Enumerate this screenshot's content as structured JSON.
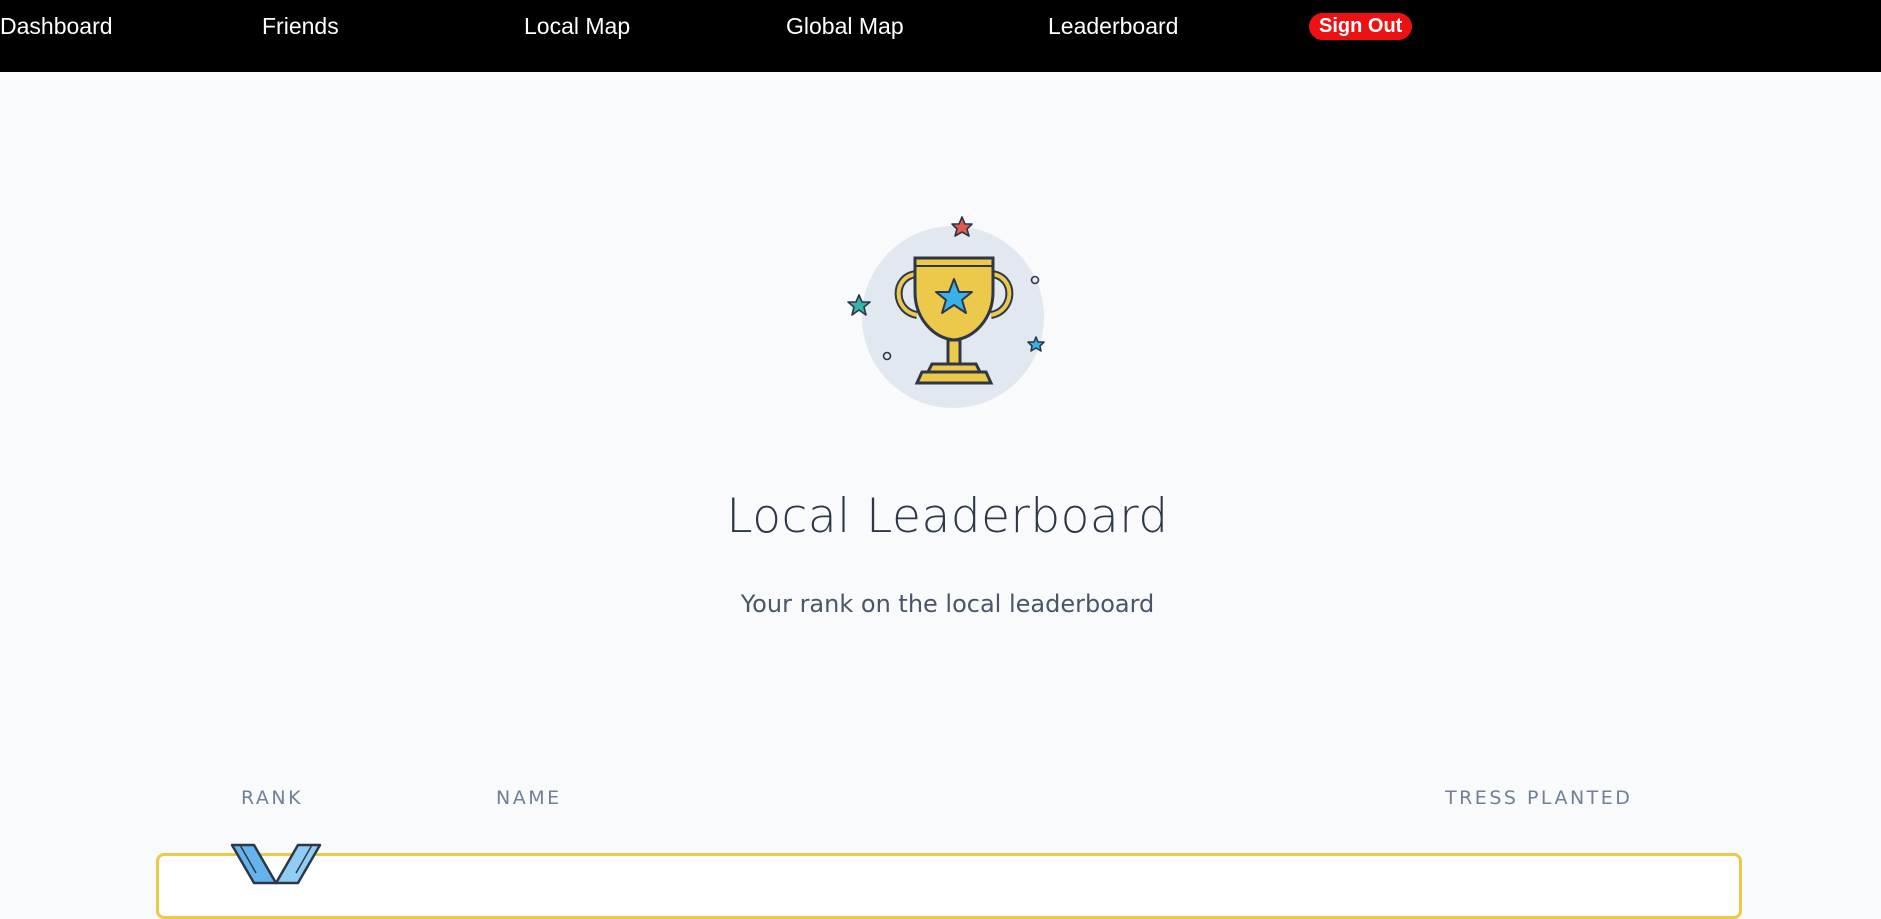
{
  "nav": {
    "links": [
      "Dashboard",
      "Friends",
      "Local Map",
      "Global Map",
      "Leaderboard"
    ],
    "signout_label": "Sign Out"
  },
  "hero": {
    "title": "Local Leaderboard",
    "subtitle": "Your rank on the local leaderboard"
  },
  "table": {
    "headers": {
      "rank": "RANK",
      "name": "NAME",
      "trees": "TRESS PLANTED"
    }
  },
  "colors": {
    "nav_bg": "#000000",
    "signout_bg": "#ee1111",
    "trophy_gold": "#ecc94b",
    "star_blue": "#38b2e6",
    "row_border": "#ecc94b"
  },
  "icons": [
    "trophy-icon",
    "medal-icon"
  ]
}
